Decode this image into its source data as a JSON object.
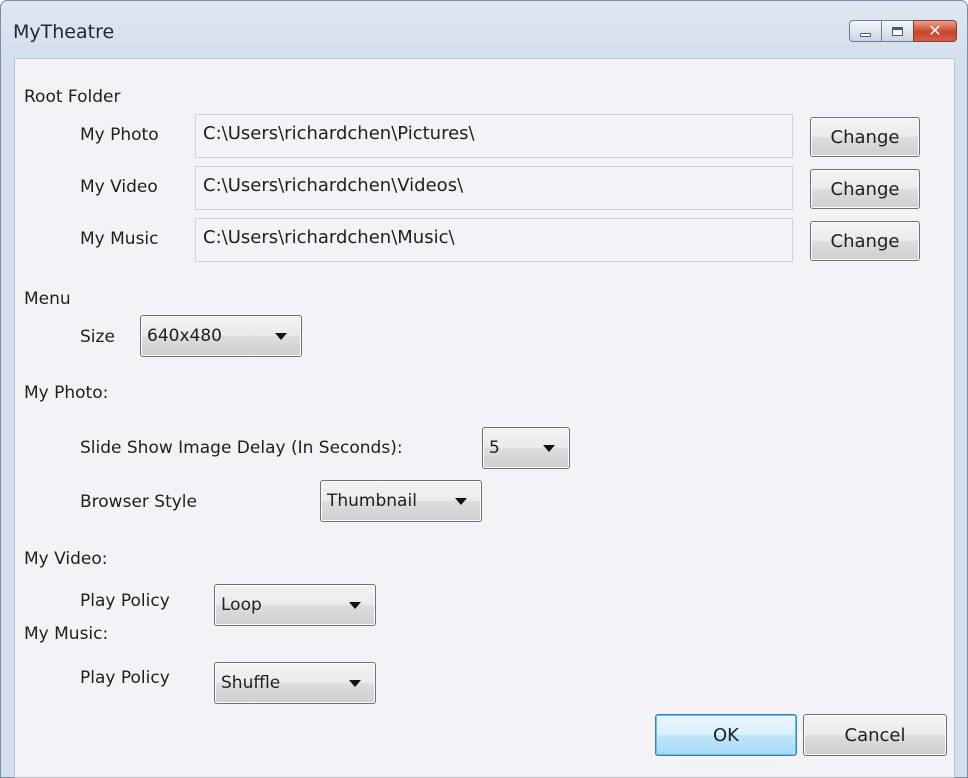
{
  "window": {
    "title": "MyTheatre"
  },
  "root_folder": {
    "heading": "Root Folder",
    "rows": [
      {
        "label": "My Photo",
        "path": "C:\\Users\\richardchen\\Pictures\\",
        "button": "Change"
      },
      {
        "label": "My Video",
        "path": "C:\\Users\\richardchen\\Videos\\",
        "button": "Change"
      },
      {
        "label": "My Music",
        "path": "C:\\Users\\richardchen\\Music\\",
        "button": "Change"
      }
    ]
  },
  "menu": {
    "heading": "Menu",
    "size_label": "Size",
    "size_value": "640x480"
  },
  "photo": {
    "heading": "My Photo:",
    "delay_label": "Slide Show Image Delay (In Seconds):",
    "delay_value": "5",
    "browser_label": "Browser Style",
    "browser_value": "Thumbnail"
  },
  "video": {
    "heading": "My Video:",
    "policy_label": "Play Policy",
    "policy_value": "Loop"
  },
  "music": {
    "heading": "My Music:",
    "policy_label": "Play Policy",
    "policy_value": "Shuffle"
  },
  "footer": {
    "ok_label": "OK",
    "cancel_label": "Cancel"
  },
  "icons": {
    "minimize": "minimize-icon",
    "maximize": "maximize-icon",
    "close": "close-icon",
    "dropdown": "chevron-down-icon"
  },
  "colors": {
    "title_bar": "#d3dfec",
    "client_bg": "#f5f2f7",
    "close_button": "#c7452b",
    "default_button": "#bee6fd"
  }
}
